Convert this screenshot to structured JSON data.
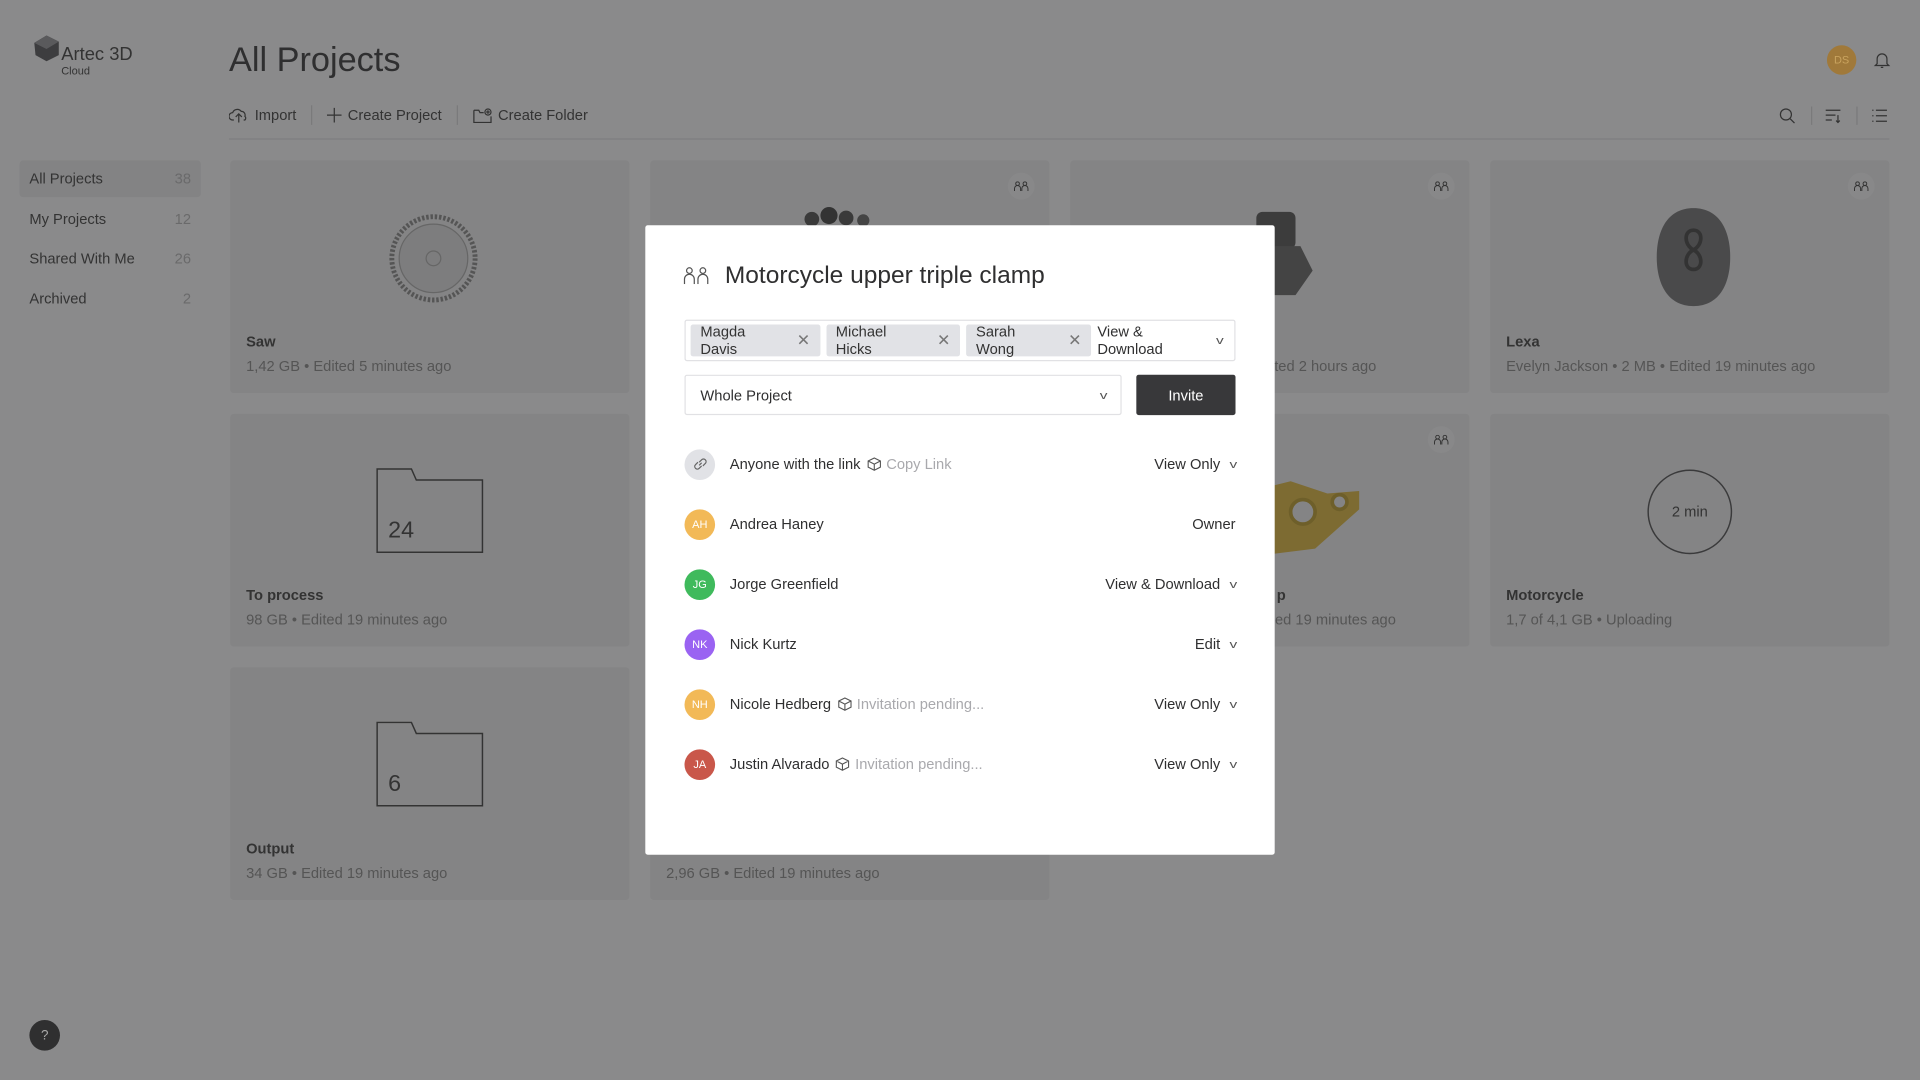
{
  "app": {
    "logo_text": "Artec 3D",
    "logo_sub": "Cloud",
    "user_initials": "DS"
  },
  "page": {
    "title": "All Projects"
  },
  "toolbar": {
    "import": "Import",
    "create_project": "Create Project",
    "create_folder": "Create Folder"
  },
  "sidebar": {
    "items": [
      {
        "label": "All Projects",
        "count": "38",
        "active": true
      },
      {
        "label": "My Projects",
        "count": "12"
      },
      {
        "label": "Shared With Me",
        "count": "26"
      },
      {
        "label": "Archived",
        "count": "2"
      }
    ]
  },
  "cards": [
    {
      "title": "Saw",
      "meta": "1,42 GB • Edited 5 minutes ago"
    },
    {
      "title": "",
      "meta": "ted 2 hours ago",
      "shared": true
    },
    {
      "title": "Lexa",
      "meta": "Evelyn Jackson • 2 MB • Edited 19 minutes ago",
      "shared": true
    },
    {
      "title": "To process",
      "meta": "98 GB • Edited 19 minutes ago",
      "folder_count": "24"
    },
    {
      "title": "p",
      "meta": "ed 19 minutes ago",
      "shared": true
    },
    {
      "title": "Motorcycle",
      "meta": "1,7 of 4,1 GB • Uploading",
      "progress_label": "2 min"
    },
    {
      "title": "Output",
      "meta": "34 GB • Edited 19 minutes ago",
      "folder_count": "6"
    },
    {
      "title": "",
      "meta": "2,96 GB • Edited 19 minutes ago"
    }
  ],
  "help": "?",
  "modal": {
    "title": "Motorcycle upper triple clamp",
    "tags": [
      "Magda Davis",
      "Michael Hicks",
      "Sarah Wong"
    ],
    "new_permission": "View & Download",
    "scope": "Whole Project",
    "invite": "Invite",
    "link_row": {
      "label": "Anyone with the link",
      "copy": "Copy Link",
      "permission": "View Only"
    },
    "members": [
      {
        "initials": "AH",
        "name": "Andrea Haney",
        "permission": "Owner",
        "color": "#f2b957"
      },
      {
        "initials": "JG",
        "name": "Jorge Greenfield",
        "permission": "View & Download",
        "color": "#3fba5c"
      },
      {
        "initials": "NK",
        "name": "Nick Kurtz",
        "permission": "Edit",
        "color": "#9a63f2"
      },
      {
        "initials": "NH",
        "name": "Nicole Hedberg",
        "status": "Invitation pending...",
        "permission": "View Only",
        "color": "#f2b957"
      },
      {
        "initials": "JA",
        "name": "Justin Alvarado",
        "status": "Invitation pending...",
        "permission": "View Only",
        "color": "#c9574a"
      }
    ]
  }
}
